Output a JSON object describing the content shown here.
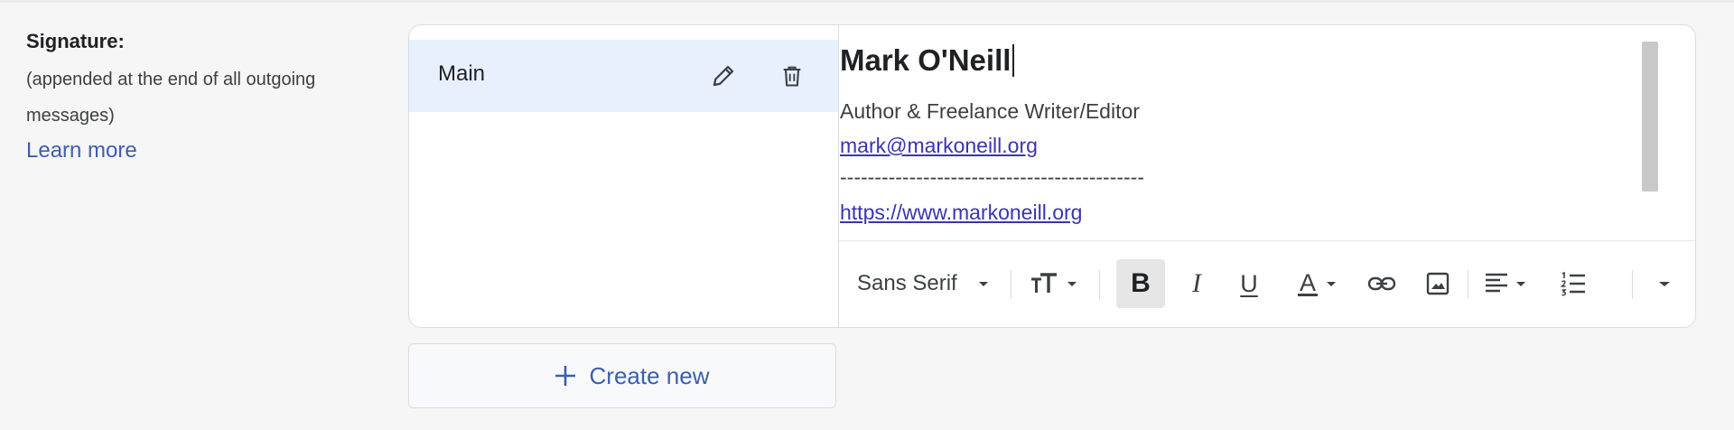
{
  "label": {
    "title": "Signature:",
    "description": "(appended at the end of all outgoing messages)",
    "learn_more": "Learn more"
  },
  "signatures": {
    "items": [
      {
        "name": "Main"
      }
    ]
  },
  "editor": {
    "name_line": "Mark O'Neill",
    "role_line": "Author & Freelance Writer/Editor",
    "email_line": "mark@markoneill.org",
    "rule_line": "--------------------------------------------",
    "url_line": "https://www.markoneill.org"
  },
  "toolbar": {
    "font_label": "Sans Serif",
    "bold_glyph": "B",
    "italic_glyph": "I",
    "underline_glyph": "U",
    "text_color_glyph": "A"
  },
  "create_new": {
    "label": "Create new"
  },
  "colors": {
    "selected_row": "#e8f0fd",
    "link": "#3a35b0",
    "accent": "#3c5fae"
  }
}
